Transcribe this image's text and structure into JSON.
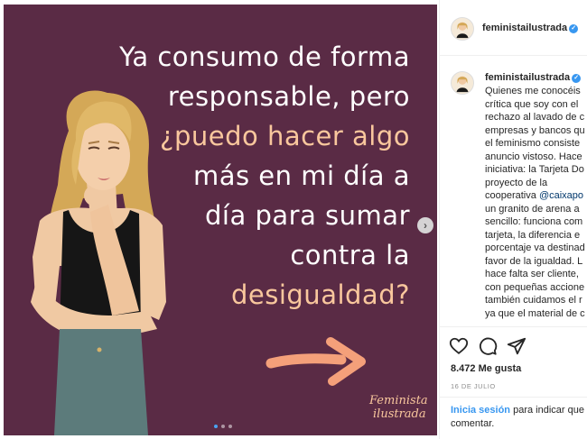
{
  "colors": {
    "post_bg": "#5a2b45",
    "quote_white": "#ffffff",
    "quote_peach": "#f9c79d",
    "arrow": "#f4a07a",
    "link_blue": "#3897f0",
    "verified_blue": "#3897f0",
    "carousel_active": "#4aa3f0"
  },
  "post": {
    "quote_lines": [
      {
        "text": "Ya consumo de forma",
        "tone": "white"
      },
      {
        "text": "responsable, pero",
        "tone": "white"
      },
      {
        "text": "¿puedo hacer algo",
        "tone": "peach"
      },
      {
        "text": "más en mi día a",
        "tone": "white"
      },
      {
        "text": "día para sumar",
        "tone": "white"
      },
      {
        "text": "contra la",
        "tone": "white"
      },
      {
        "text": "desigualdad?",
        "tone": "peach"
      }
    ],
    "brand_line1": "Feminista",
    "brand_line2": "ilustrada",
    "next_icon": "chevron-right-icon",
    "next_glyph": "›",
    "carousel": {
      "count": 3,
      "active": 1
    }
  },
  "header": {
    "username": "feministailustrada",
    "verified_glyph": "✓"
  },
  "caption": {
    "username": "feministailustrada",
    "lines": [
      "Quienes me conocéis",
      "crítica que soy con el",
      "rechazo al lavado de c",
      "empresas y bancos qu",
      "el feminismo consiste",
      "anuncio vistoso. Hace",
      "iniciativa: la Tarjeta Do",
      "proyecto de la",
      "cooperativa @caixapo",
      "un granito de arena a",
      "sencillo: funciona com",
      "tarjeta, la diferencia e",
      "porcentaje va destinad",
      "favor de la igualdad. L",
      "hace falta ser cliente,",
      "con pequeñas accione",
      "también cuidamos el r",
      "ya que el material de c"
    ],
    "mention_line": 8,
    "mention_prefix": "cooperativa ",
    "mention_text": "@caixapo"
  },
  "actions": {
    "like_icon": "heart-icon",
    "comment_icon": "comment-icon",
    "share_icon": "share-icon",
    "likes": "8.472 Me gusta",
    "date": "16 DE JULIO"
  },
  "login": {
    "link_text": "Inicia sesión",
    "text_after": " para indicar que",
    "line2": "comentar."
  }
}
